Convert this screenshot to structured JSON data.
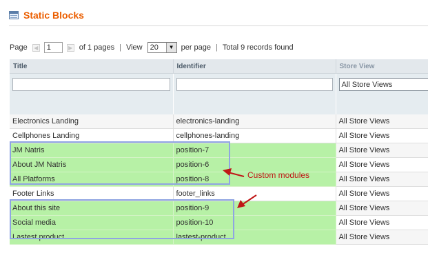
{
  "header": {
    "title": "Static Blocks"
  },
  "pager": {
    "page_label": "Page",
    "page_value": "1",
    "of_pages": "of 1 pages",
    "view_label": "View",
    "per_page_value": "20",
    "per_page_label": "per page",
    "total": "Total 9 records found"
  },
  "grid": {
    "columns": [
      "Title",
      "Identifier",
      "Store View"
    ],
    "filters": {
      "title": "",
      "identifier": "",
      "store_view": "All Store Views"
    },
    "rows": [
      {
        "title": "Electronics Landing",
        "identifier": "electronics-landing",
        "store": "All Store Views",
        "highlighted": false
      },
      {
        "title": "Cellphones Landing",
        "identifier": "cellphones-landing",
        "store": "All Store Views",
        "highlighted": false
      },
      {
        "title": "JM Natris",
        "identifier": "position-7",
        "store": "All Store Views",
        "highlighted": true
      },
      {
        "title": "About JM Natris",
        "identifier": "position-6",
        "store": "All Store Views",
        "highlighted": true
      },
      {
        "title": "All Platforms",
        "identifier": "position-8",
        "store": "All Store Views",
        "highlighted": true
      },
      {
        "title": "Footer Links",
        "identifier": "footer_links",
        "store": "All Store Views",
        "highlighted": false
      },
      {
        "title": "About this site",
        "identifier": "position-9",
        "store": "All Store Views",
        "highlighted": true
      },
      {
        "title": "Social media",
        "identifier": "position-10",
        "store": "All Store Views",
        "highlighted": true
      },
      {
        "title": "Lastest product",
        "identifier": "lastest-product",
        "store": "All Store Views",
        "highlighted": true
      }
    ]
  },
  "annotation": {
    "label": "Custom modules",
    "color": "#c01616"
  },
  "colors": {
    "title": "#eb5e00",
    "highlight": "#b7f1a6",
    "box_border": "#8fa4e2"
  }
}
